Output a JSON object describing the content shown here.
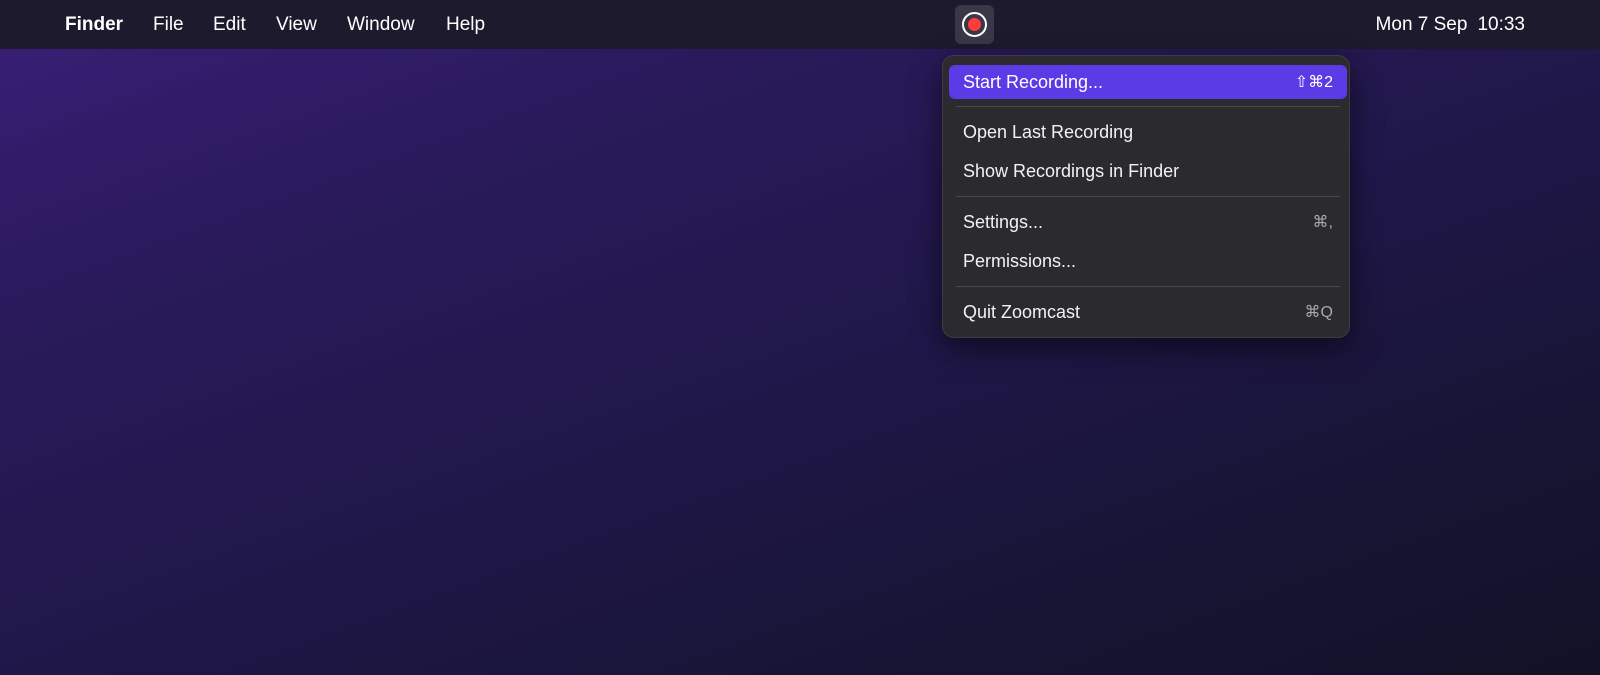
{
  "menubar": {
    "app_name": "Finder",
    "menus": [
      "File",
      "Edit",
      "View",
      "Window",
      "Help"
    ],
    "tray_icon": "record-icon",
    "clock_date": "Mon 7 Sep",
    "clock_time": "10:33"
  },
  "dropdown": {
    "app": "Zoomcast",
    "items": [
      {
        "label": "Start Recording...",
        "shortcut": "⇧⌘2",
        "highlighted": true
      },
      {
        "label": "Open Last Recording",
        "shortcut": ""
      },
      {
        "label": "Show Recordings in Finder",
        "shortcut": ""
      },
      {
        "label": "Settings...",
        "shortcut": "⌘,"
      },
      {
        "label": "Permissions...",
        "shortcut": ""
      },
      {
        "label": "Quit Zoomcast",
        "shortcut": "⌘Q"
      }
    ]
  },
  "colors": {
    "accent": "#5a3be6",
    "record_dot": "#ff3b3b",
    "menu_bg": "#2b2a2e",
    "menubar_bg": "#1e1a2e"
  }
}
